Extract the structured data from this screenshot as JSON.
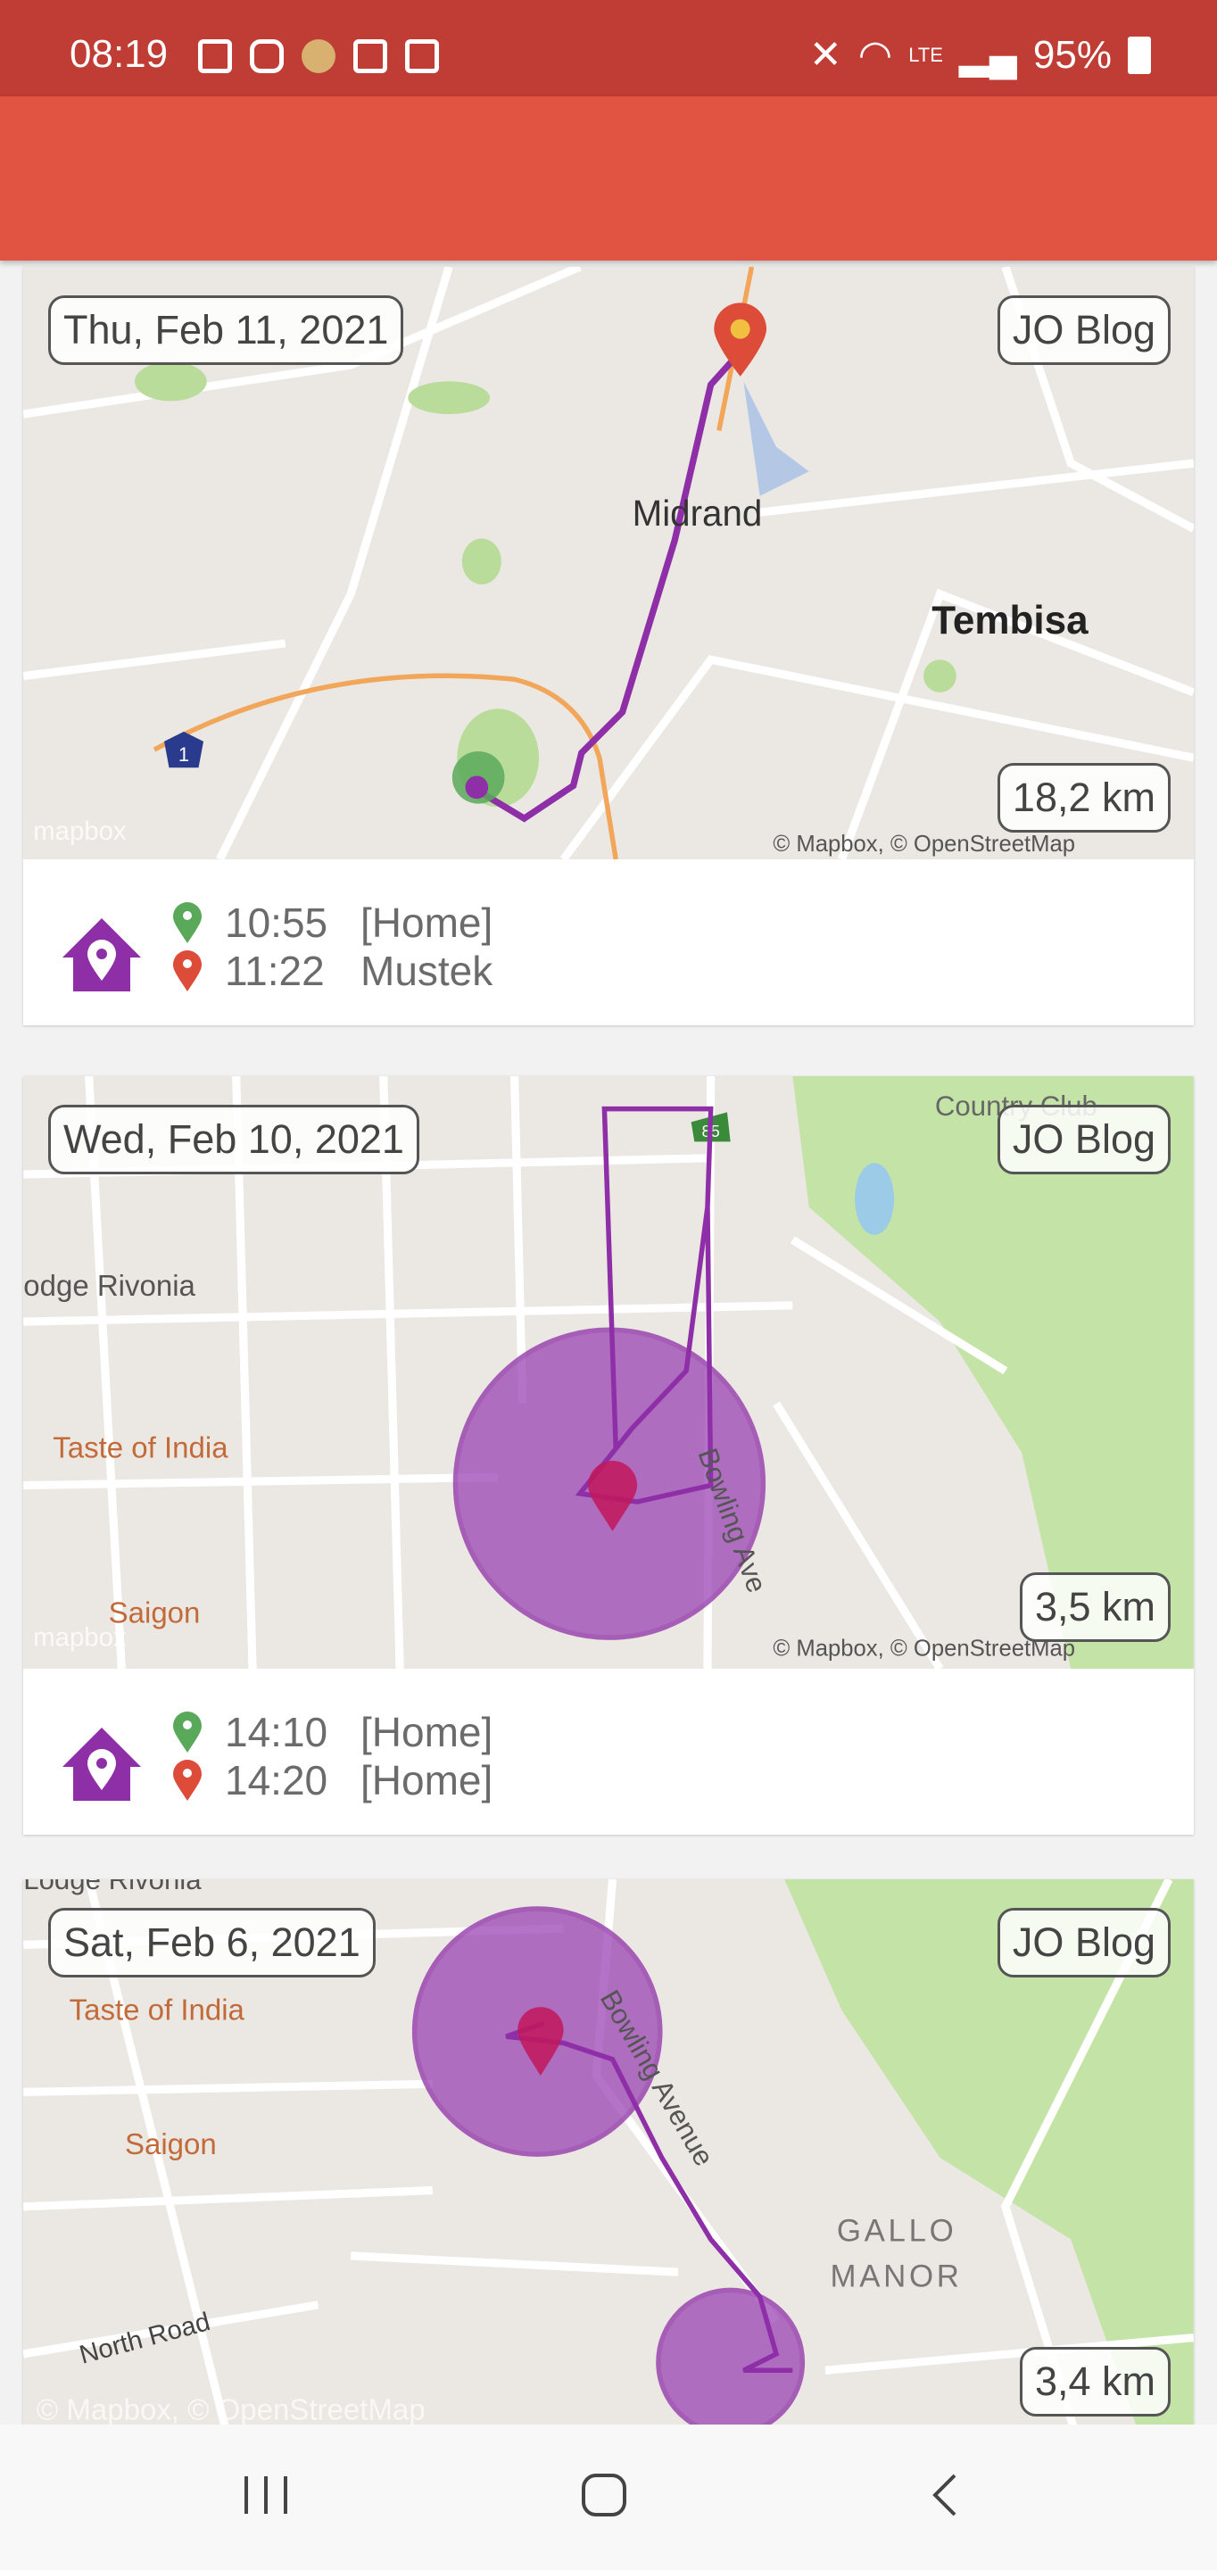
{
  "status_bar": {
    "time": "08:19",
    "battery": "95%",
    "network": "LTE",
    "colors": {
      "bar": "#c03d35"
    }
  },
  "app_bar": {
    "color": "#e05441"
  },
  "cards": [
    {
      "date": "Thu, Feb 11, 2021",
      "owner": "JO Blog",
      "distance": "18,2 km",
      "start": {
        "time": "10:55",
        "place": "[Home]"
      },
      "end": {
        "time": "11:22",
        "place": "Mustek"
      },
      "map_labels": {
        "a": "Midrand",
        "b": "Tembisa",
        "shield": "1"
      },
      "attribution": "© Mapbox, © OpenStreetMap",
      "logo": "mapbox"
    },
    {
      "date": "Wed, Feb 10, 2021",
      "owner": "JO Blog",
      "distance": "3,5 km",
      "start": {
        "time": "14:10",
        "place": "[Home]"
      },
      "end": {
        "time": "14:20",
        "place": "[Home]"
      },
      "map_labels": {
        "a": "Country Club",
        "b": "odge Rivonia",
        "c": "Taste of India",
        "d": "Saigon",
        "e": "Bowling Ave",
        "shield": "85"
      },
      "attribution": "© Mapbox, © OpenStreetMap",
      "logo": "mapbox"
    },
    {
      "date": "Sat, Feb 6, 2021",
      "owner": "JO Blog",
      "distance": "3,4 km",
      "map_labels": {
        "a": "Lodge Rivonia",
        "b": "Taste of India",
        "c": "Saigon",
        "d": "North Road",
        "e": "Bowling Avenue",
        "f": "GALLO",
        "g": "MANOR"
      },
      "attribution": "© Mapbox, © OpenStreetMap"
    }
  ],
  "colors": {
    "route": "#8e2fa8",
    "start_pin": "#5aa95a",
    "end_pin": "#dd4b39",
    "home_icon": "#8e2fa8"
  },
  "nav_bar": {
    "buttons": [
      "recent-apps",
      "home",
      "back"
    ]
  }
}
